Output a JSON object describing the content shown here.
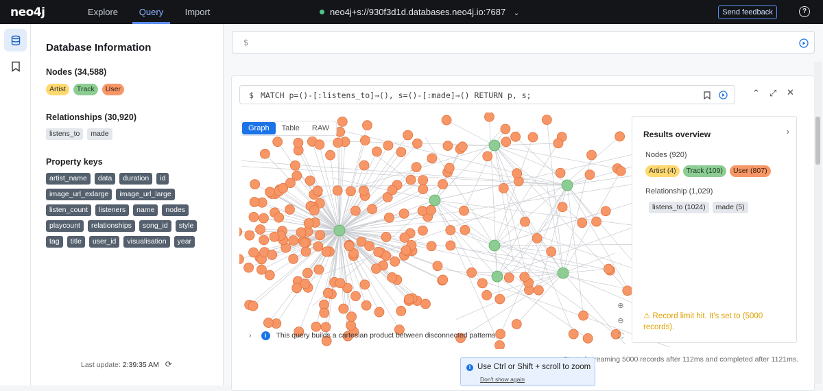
{
  "topbar": {
    "logo": "neo4j",
    "tabs": [
      {
        "label": "Explore"
      },
      {
        "label": "Query",
        "active": true
      },
      {
        "label": "Import"
      }
    ],
    "connection": "neo4j+s://930f3d1d.databases.neo4j.io:7687",
    "feedback_label": "Send feedback",
    "help_icon": "?"
  },
  "sidebar": {
    "title": "Database Information",
    "nodes_heading": "Nodes (34,588)",
    "node_labels": [
      {
        "label": "Artist",
        "kind": "artist"
      },
      {
        "label": "Track",
        "kind": "track"
      },
      {
        "label": "User",
        "kind": "user"
      }
    ],
    "rels_heading": "Relationships (30,920)",
    "rel_types": [
      {
        "label": "listens_to"
      },
      {
        "label": "made"
      }
    ],
    "props_heading": "Property keys",
    "property_keys": [
      "artist_name",
      "data",
      "duration",
      "id",
      "image_url_exlarge",
      "image_url_large",
      "listen_count",
      "listeners",
      "name",
      "nodes",
      "playcount",
      "relationships",
      "song_id",
      "style",
      "tag",
      "title",
      "user_id",
      "visualisation",
      "year"
    ],
    "last_update_label": "Last update:",
    "last_update_time": "2:39:35 AM"
  },
  "editor": {
    "prompt": "$"
  },
  "frame": {
    "prompt": "$",
    "query": "MATCH p=()-[:listens_to]→(), s=()-[:made]→() RETURN p, s;",
    "view_tabs": [
      {
        "label": "Graph",
        "active": true
      },
      {
        "label": "Table"
      },
      {
        "label": "RAW"
      }
    ],
    "overview": {
      "title": "Results overview",
      "nodes_heading": "Nodes (920)",
      "node_chips": [
        {
          "label": "Artist (4)",
          "kind": "artist"
        },
        {
          "label": "Track (109)",
          "kind": "track"
        },
        {
          "label": "User (807)",
          "kind": "user"
        }
      ],
      "rel_heading": "Relationship (1,029)",
      "rel_chips": [
        {
          "label": "listens_to (1024)"
        },
        {
          "label": "made (5)"
        }
      ],
      "warning": "Record limit hit. It's set to (5000 records)."
    },
    "zoom_tip": {
      "text": "Use Ctrl or Shift + scroll to zoom",
      "link": "Don't show again"
    },
    "status": "Started streaming 5000 records after 112ms and completed after 1121ms."
  },
  "next_note": "This query builds a cartesian product between disconnected patterns",
  "colors": {
    "artist": "#ffd86e",
    "track": "#8dcc93",
    "user": "#f79767",
    "accent": "#1a73e8"
  }
}
